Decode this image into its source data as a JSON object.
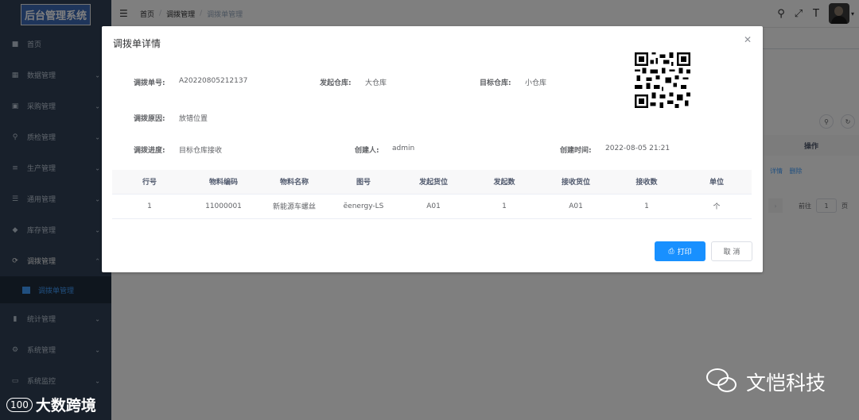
{
  "sidebar": {
    "logo": "后台管理系统",
    "items": [
      {
        "label": "首页",
        "icon": "dashboard-icon",
        "has_children": false
      },
      {
        "label": "数据管理",
        "icon": "table-icon",
        "has_children": true
      },
      {
        "label": "采购管理",
        "icon": "cart-icon",
        "has_children": true
      },
      {
        "label": "质检管理",
        "icon": "search-icon",
        "has_children": true
      },
      {
        "label": "生产管理",
        "icon": "sliders-icon",
        "has_children": true
      },
      {
        "label": "通用管理",
        "icon": "list-icon",
        "has_children": true
      },
      {
        "label": "库存管理",
        "icon": "box-icon",
        "has_children": true
      },
      {
        "label": "调拨管理",
        "icon": "transfer-icon",
        "has_children": true,
        "expanded": true
      }
    ],
    "subitem": {
      "label": "调拨单管理",
      "icon": "doc-icon"
    },
    "items_after": [
      {
        "label": "统计管理",
        "icon": "chart-icon",
        "has_children": true
      },
      {
        "label": "系统管理",
        "icon": "gear-icon",
        "has_children": true
      },
      {
        "label": "系统监控",
        "icon": "monitor-icon",
        "has_children": true
      }
    ]
  },
  "topbar": {
    "breadcrumb": [
      "首页",
      "调拨管理",
      "调拨单管理"
    ]
  },
  "main": {
    "table_header": "操作",
    "row_actions": [
      "详情",
      "删除"
    ],
    "pager": {
      "goto_label": "前往",
      "page": "1",
      "page_unit": "页"
    }
  },
  "dialog": {
    "title": "调拨单详情",
    "fields": {
      "order_no_label": "调拨单号:",
      "order_no": "A20220805212137",
      "from_wh_label": "发起仓库:",
      "from_wh": "大仓库",
      "to_wh_label": "目标仓库:",
      "to_wh": "小仓库",
      "reason_label": "调拨原因:",
      "reason": "放错位置",
      "progress_label": "调拨进度:",
      "progress": "目标仓库接收",
      "creator_label": "创建人:",
      "creator": "admin",
      "created_label": "创建时间:",
      "created": "2022-08-05 21:21"
    },
    "table": {
      "headers": [
        "行号",
        "物料编码",
        "物料名称",
        "图号",
        "发起货位",
        "发起数",
        "接收货位",
        "接收数",
        "单位"
      ],
      "rows": [
        [
          "1",
          "11000001",
          "新能源车螺丝",
          "ӗenergy-LS",
          "A01",
          "1",
          "A01",
          "1",
          "个"
        ]
      ]
    },
    "print_label": "打印",
    "cancel_label": "取 消"
  },
  "watermarks": {
    "left": "大数跨境",
    "left_logo": "100",
    "right": "文恺科技"
  },
  "colors": {
    "sidebar_bg": "#304156",
    "primary": "#1890ff",
    "active_menu": "#409eff"
  }
}
